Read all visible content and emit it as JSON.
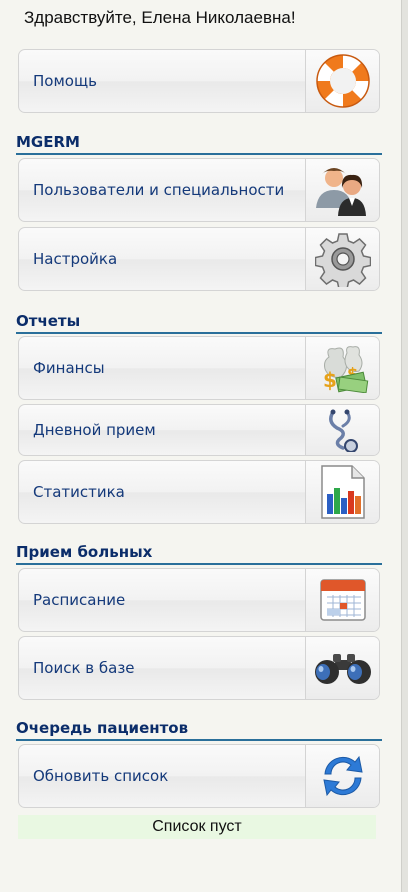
{
  "greeting": "Здравствуйте, Елена Николаевна!",
  "help": {
    "label": "Помощь",
    "icon": "lifebuoy-icon"
  },
  "sections": {
    "mgerm": {
      "title": "MGERM",
      "items": [
        {
          "label": "Пользователи и специальности",
          "icon": "users-icon"
        },
        {
          "label": "Настройка",
          "icon": "gear-icon"
        }
      ]
    },
    "reports": {
      "title": "Отчеты",
      "items": [
        {
          "label": "Финансы",
          "icon": "money-icon"
        },
        {
          "label": "Дневной прием",
          "icon": "stethoscope-icon"
        },
        {
          "label": "Статистика",
          "icon": "bar-chart-icon"
        }
      ]
    },
    "patients": {
      "title": "Прием больных",
      "items": [
        {
          "label": "Расписание",
          "icon": "calendar-icon"
        },
        {
          "label": "Поиск в базе",
          "icon": "binoculars-icon"
        }
      ]
    },
    "queue": {
      "title": "Очередь пациентов",
      "items": [
        {
          "label": "Обновить список",
          "icon": "refresh-icon"
        }
      ]
    }
  },
  "queue_status": "Список пуст",
  "colors": {
    "section_title": "#0b2d6a",
    "section_rule": "#2a6f9a",
    "item_label": "#14397a",
    "status_bg": "#e9f8e2"
  }
}
